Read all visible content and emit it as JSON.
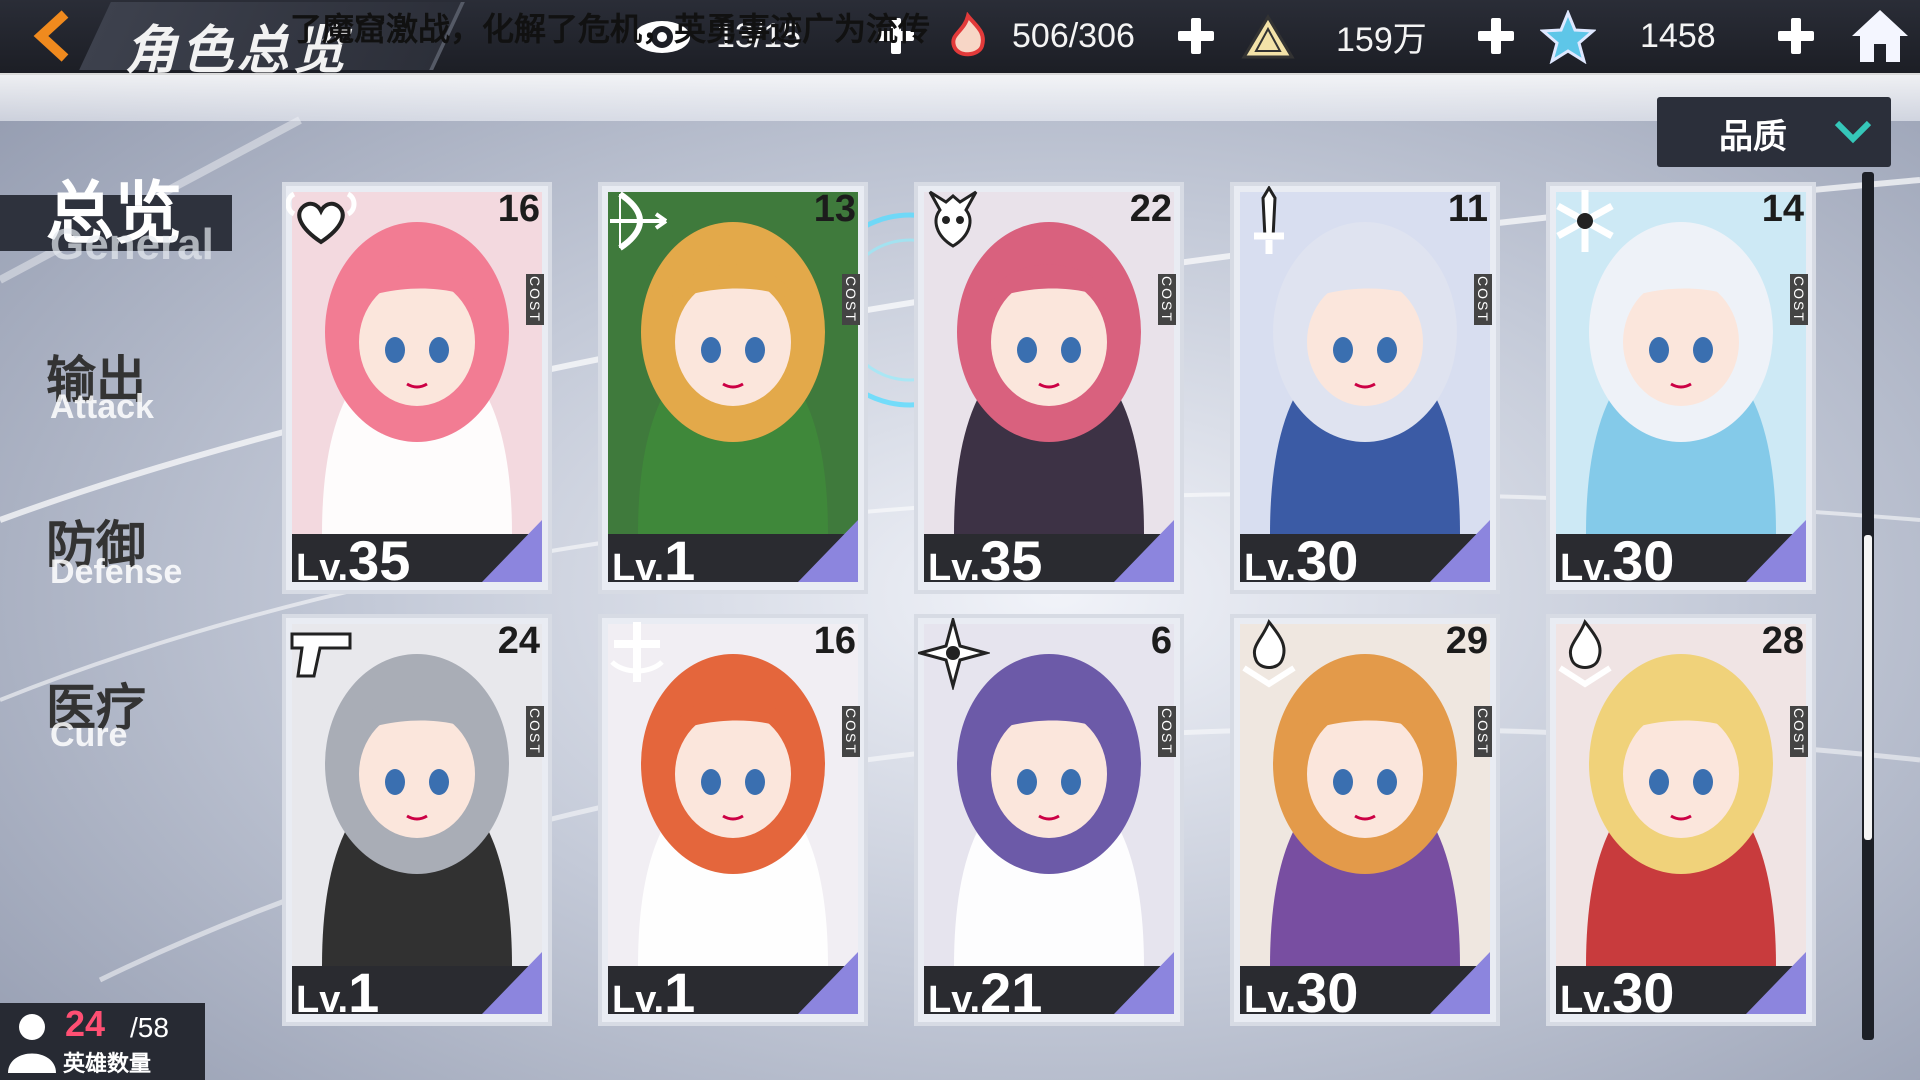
{
  "header": {
    "title": "角色总览",
    "resources": [
      {
        "icon": "eye-icon",
        "value": "13/15"
      },
      {
        "icon": "flame-hand-icon",
        "value": "506/306"
      },
      {
        "icon": "pyramid-icon",
        "value": "159万"
      },
      {
        "icon": "star-icon",
        "value": "1458"
      }
    ]
  },
  "marquee": {
    "text": "了魔窟激战，化解了危机，英勇事迹广为流传"
  },
  "sort": {
    "label": "品质"
  },
  "tabs": [
    {
      "cn": "总览",
      "en": "General",
      "active": true
    },
    {
      "cn": "输出",
      "en": "Attack",
      "active": false
    },
    {
      "cn": "防御",
      "en": "Defense",
      "active": false
    },
    {
      "cn": "医疗",
      "en": "Cure",
      "active": false
    }
  ],
  "cost_label": "COST",
  "lv_prefix": "Lv.",
  "cards": [
    {
      "cost": "16",
      "level": "35",
      "class_icon": "heart-wings-icon",
      "hair": "#f27c93",
      "accent": "#ffffff",
      "bg": "#f3d9df"
    },
    {
      "cost": "13",
      "level": "1",
      "class_icon": "bow-icon",
      "hair": "#e3a94a",
      "accent": "#3f8a3a",
      "bg": "#3f7a3c"
    },
    {
      "cost": "22",
      "level": "35",
      "class_icon": "demon-skull-icon",
      "hair": "#d9617e",
      "accent": "#2a1f33",
      "bg": "#e9e2ea"
    },
    {
      "cost": "11",
      "level": "30",
      "class_icon": "sword-icon",
      "hair": "#dfe3f0",
      "accent": "#2a4c9c",
      "bg": "#d8def0"
    },
    {
      "cost": "14",
      "level": "30",
      "class_icon": "snowflake-icon",
      "hair": "#eef2f8",
      "accent": "#7cc6e8",
      "bg": "#cde9f5"
    },
    {
      "cost": "24",
      "level": "1",
      "class_icon": "gun-icon",
      "hair": "#a9adb6",
      "accent": "#1d1d1d",
      "bg": "#e8e8ec"
    },
    {
      "cost": "16",
      "level": "1",
      "class_icon": "cross-emblem-icon",
      "hair": "#e4663c",
      "accent": "#ffffff",
      "bg": "#f1eef3"
    },
    {
      "cost": "6",
      "level": "21",
      "class_icon": "shuriken-icon",
      "hair": "#6c5aa8",
      "accent": "#ffffff",
      "bg": "#e6e4ee"
    },
    {
      "cost": "29",
      "level": "30",
      "class_icon": "flame-emblem-icon",
      "hair": "#e39a4a",
      "accent": "#6a3d9a",
      "bg": "#efe7e0"
    },
    {
      "cost": "28",
      "level": "30",
      "class_icon": "flame-emblem-icon",
      "hair": "#f0d27a",
      "accent": "#c3282a",
      "bg": "#f0e4e4"
    }
  ],
  "hero_count": {
    "current": "24",
    "max": "/58",
    "label": "英雄数量"
  }
}
